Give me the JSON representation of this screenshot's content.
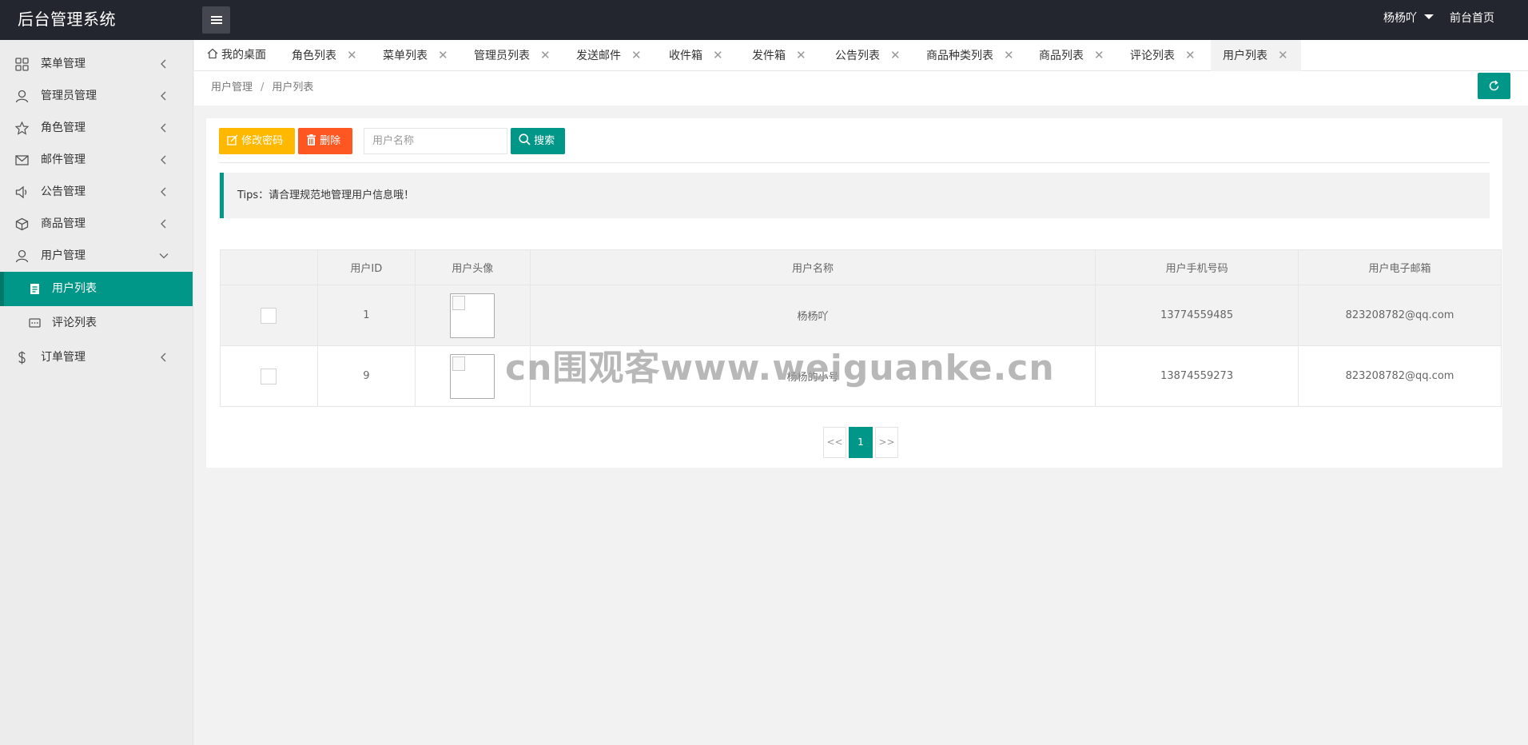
{
  "colors": {
    "accent": "#009688",
    "warm": "#ffb800",
    "danger": "#ff5722",
    "header_bg": "#23262e"
  },
  "header": {
    "logo": "后台管理系统",
    "user": "杨杨吖",
    "home_link": "前台首页"
  },
  "sidebar": {
    "items": [
      {
        "label": "菜单管理",
        "icon": "grid-icon"
      },
      {
        "label": "管理员管理",
        "icon": "user-icon"
      },
      {
        "label": "角色管理",
        "icon": "star-icon"
      },
      {
        "label": "邮件管理",
        "icon": "mail-icon"
      },
      {
        "label": "公告管理",
        "icon": "speaker-icon"
      },
      {
        "label": "商品管理",
        "icon": "box-icon"
      },
      {
        "label": "用户管理",
        "icon": "user-icon",
        "expanded": true
      }
    ],
    "sub_items": [
      {
        "label": "用户列表",
        "icon": "list-icon",
        "active": true
      },
      {
        "label": "评论列表",
        "icon": "comment-icon"
      }
    ],
    "last_item": {
      "label": "订单管理",
      "icon": "dollar-icon"
    }
  },
  "tabs": [
    {
      "label": "我的桌面",
      "icon": "home-icon"
    },
    {
      "label": "角色列表"
    },
    {
      "label": "菜单列表"
    },
    {
      "label": "管理员列表"
    },
    {
      "label": "发送邮件"
    },
    {
      "label": "收件箱"
    },
    {
      "label": "发件箱"
    },
    {
      "label": "公告列表"
    },
    {
      "label": "商品种类列表"
    },
    {
      "label": "商品列表"
    },
    {
      "label": "评论列表"
    },
    {
      "label": "用户列表",
      "active": true
    }
  ],
  "tab_close": "✕",
  "breadcrumb": {
    "parent": "用户管理",
    "separator": "/",
    "current": "用户列表"
  },
  "toolbar": {
    "change_password": "修改密码",
    "delete": "删除",
    "search_placeholder": "用户名称",
    "search": "搜索"
  },
  "tips": "Tips：请合理规范地管理用户信息哦！",
  "table": {
    "columns": [
      "",
      "用户ID",
      "用户头像",
      "用户名称",
      "用户手机号码",
      "用户电子邮箱"
    ],
    "rows": [
      {
        "id": "1",
        "name": "杨杨吖",
        "phone": "13774559485",
        "email": "823208782@qq.com"
      },
      {
        "id": "9",
        "name": "杨杨的小号",
        "phone": "13874559273",
        "email": "823208782@qq.com"
      }
    ]
  },
  "pagination": {
    "prev": "<<",
    "current": "1",
    "next": ">>"
  },
  "watermark": "cn围观客www.weiguanke.cn"
}
